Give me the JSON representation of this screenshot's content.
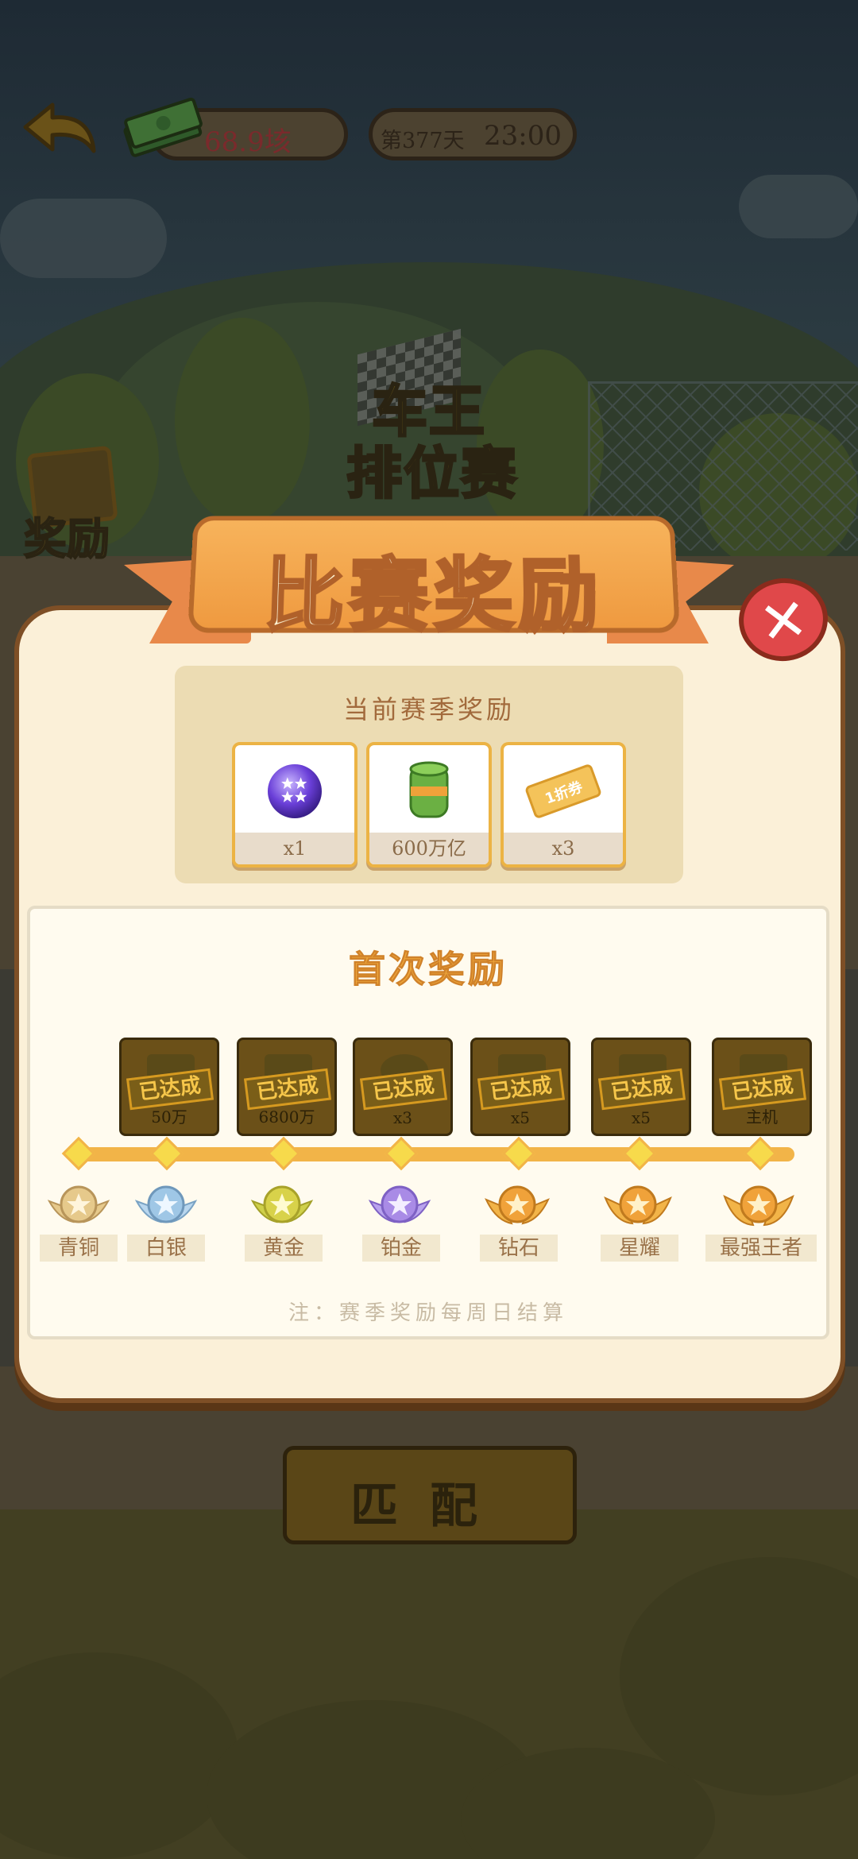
{
  "topbar": {
    "money": "68.9垓",
    "day_label": "第377天",
    "time": "23:00"
  },
  "background": {
    "event_title_line1": "车王",
    "event_title_line2": "排位赛",
    "side_reward_label": "奖励"
  },
  "modal": {
    "title": "比赛奖励",
    "season": {
      "title": "当前赛季奖励",
      "items": [
        {
          "icon": "star-orb-icon",
          "label": "x1"
        },
        {
          "icon": "cash-roll-icon",
          "label": "600万亿"
        },
        {
          "icon": "discount-ticket-icon",
          "label": "x3",
          "ticket_text": "1折券"
        }
      ]
    },
    "first_reward": {
      "title": "首次奖励",
      "tiers": [
        {
          "rank": "青铜",
          "medal_color": "#e6c98b"
        },
        {
          "rank": "白银",
          "medal_color": "#9fc7e6",
          "achieved": "已达成",
          "amount": "50万"
        },
        {
          "rank": "黄金",
          "medal_color": "#d8d24a",
          "achieved": "已达成",
          "amount": "6800万"
        },
        {
          "rank": "铂金",
          "medal_color": "#a98be6",
          "achieved": "已达成",
          "amount": "x3"
        },
        {
          "rank": "钻石",
          "medal_color": "#f0a23a",
          "achieved": "已达成",
          "amount": "x5"
        },
        {
          "rank": "星耀",
          "medal_color": "#f0a23a",
          "achieved": "已达成",
          "amount": "x5"
        },
        {
          "rank": "最强王者",
          "medal_color": "#f0a23a",
          "achieved": "已达成",
          "amount": "主机"
        }
      ]
    },
    "note": "注：赛季奖励每周日结算"
  },
  "match_button": "匹配"
}
